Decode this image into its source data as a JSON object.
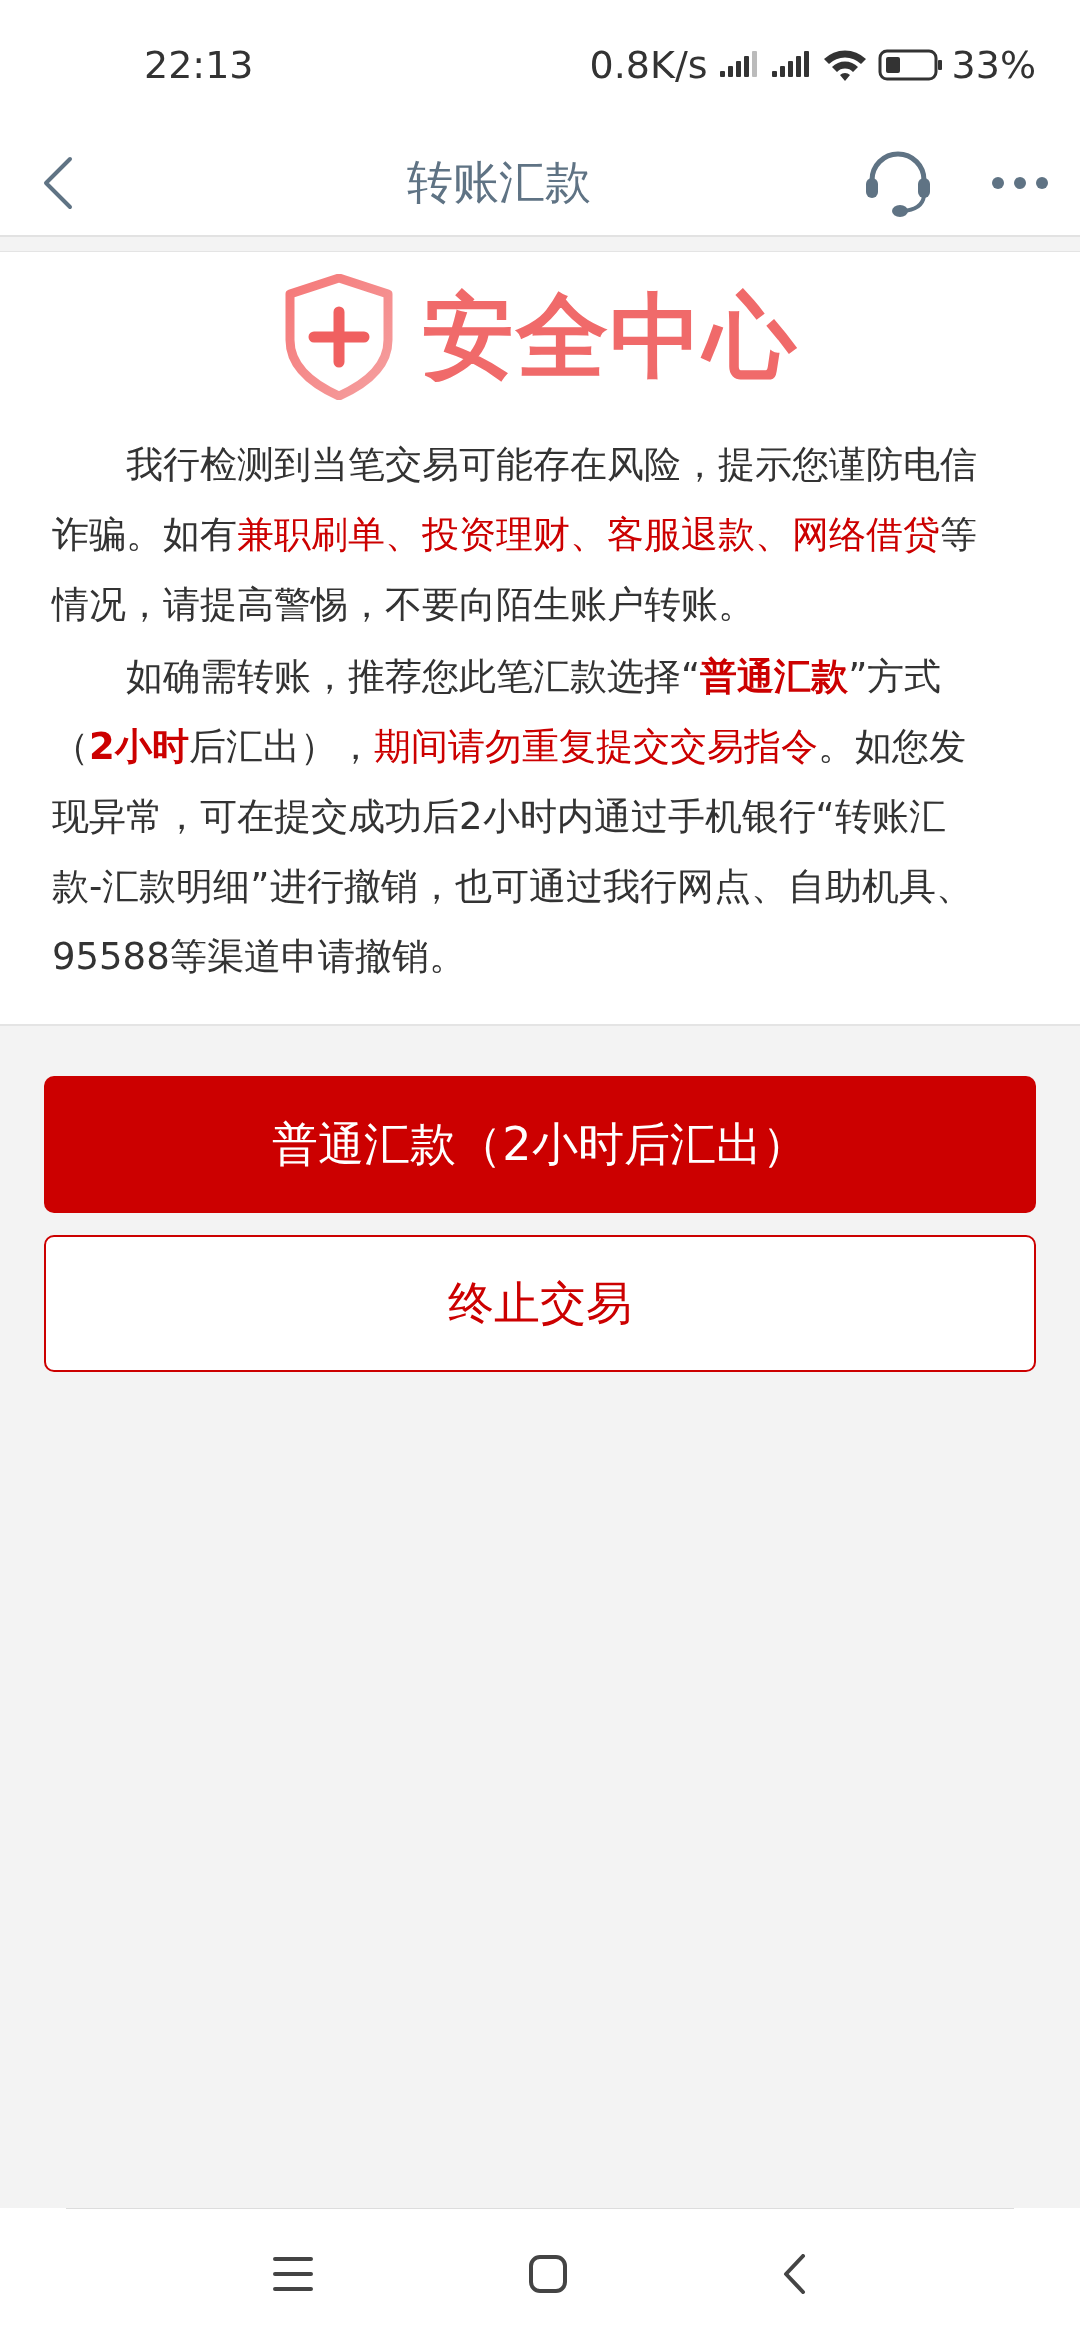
{
  "status_bar": {
    "time": "22:13",
    "net_speed": "0.8K/s",
    "battery": "33%"
  },
  "nav_bar": {
    "title": "转账汇款"
  },
  "banner": {
    "title": "安全中心"
  },
  "paragraphs": [
    [
      {
        "text": "我行检测到当笔交易可能存在风险，提示您谨防电信诈骗。如有",
        "kind": "normal"
      },
      {
        "text": "兼职刷单、投资理财、客服退款、网络借贷",
        "kind": "warning"
      },
      {
        "text": "等情况，请提高警惕，不要向陌生账户转账。",
        "kind": "normal"
      }
    ],
    [
      {
        "text": "如确需转账，推荐您此笔汇款选择“",
        "kind": "normal"
      },
      {
        "text": "普通汇款",
        "kind": "emphasis"
      },
      {
        "text": "”方式（",
        "kind": "normal"
      },
      {
        "text": "2小时",
        "kind": "emphasis"
      },
      {
        "text": "后汇出），",
        "kind": "normal"
      },
      {
        "text": "期间请勿重复提交交易指令",
        "kind": "warning"
      },
      {
        "text": "。如您发现异常，可在提交成功后2小时内通过手机银行“转账汇款-汇款明细”进行撤销，也可通过我行网点、自助机具、95588等渠道申请撤销。",
        "kind": "normal"
      }
    ]
  ],
  "buttons": [
    {
      "label": "普通汇款（2小时后汇出）",
      "kind": "primary"
    },
    {
      "label": "终止交易",
      "kind": "outline"
    }
  ]
}
